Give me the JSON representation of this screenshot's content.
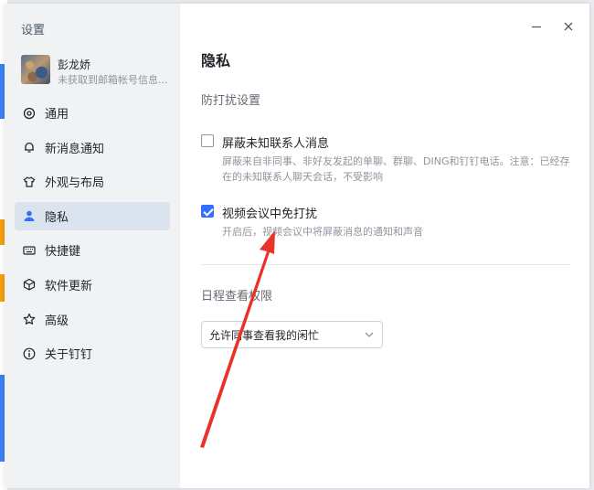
{
  "colors": {
    "accent": "#3370ff",
    "sidebar_bg": "#f1f2f4",
    "active_item_bg": "#dbe3ee",
    "annotation_arrow": "#e8322a"
  },
  "sidebar": {
    "title": "设置",
    "profile": {
      "name": "彭龙娇",
      "subtitle": "未获取到邮箱帐号信息..."
    },
    "items": [
      {
        "label": "通用",
        "icon": "gear-icon"
      },
      {
        "label": "新消息通知",
        "icon": "bell-icon"
      },
      {
        "label": "外观与布局",
        "icon": "shirt-icon"
      },
      {
        "label": "隐私",
        "icon": "user-icon",
        "active": true
      },
      {
        "label": "快捷键",
        "icon": "keyboard-icon"
      },
      {
        "label": "软件更新",
        "icon": "cube-icon"
      },
      {
        "label": "高级",
        "icon": "star-icon"
      },
      {
        "label": "关于钉钉",
        "icon": "info-icon"
      }
    ]
  },
  "main": {
    "title": "隐私",
    "dnd_section": "防打扰设置",
    "options": [
      {
        "title": "屏蔽未知联系人消息",
        "desc": "屏蔽来自非同事、非好友发起的单聊、群聊、DING和钉钉电话。注意：已经存在的未知联系人聊天会话，不受影响",
        "checked": false
      },
      {
        "title": "视频会议中免打扰",
        "desc": "开启后，视频会议中将屏蔽消息的通知和声音",
        "checked": true
      }
    ],
    "schedule_section": "日程查看权限",
    "schedule_select": {
      "value": "允许同事查看我的闲忙"
    }
  }
}
